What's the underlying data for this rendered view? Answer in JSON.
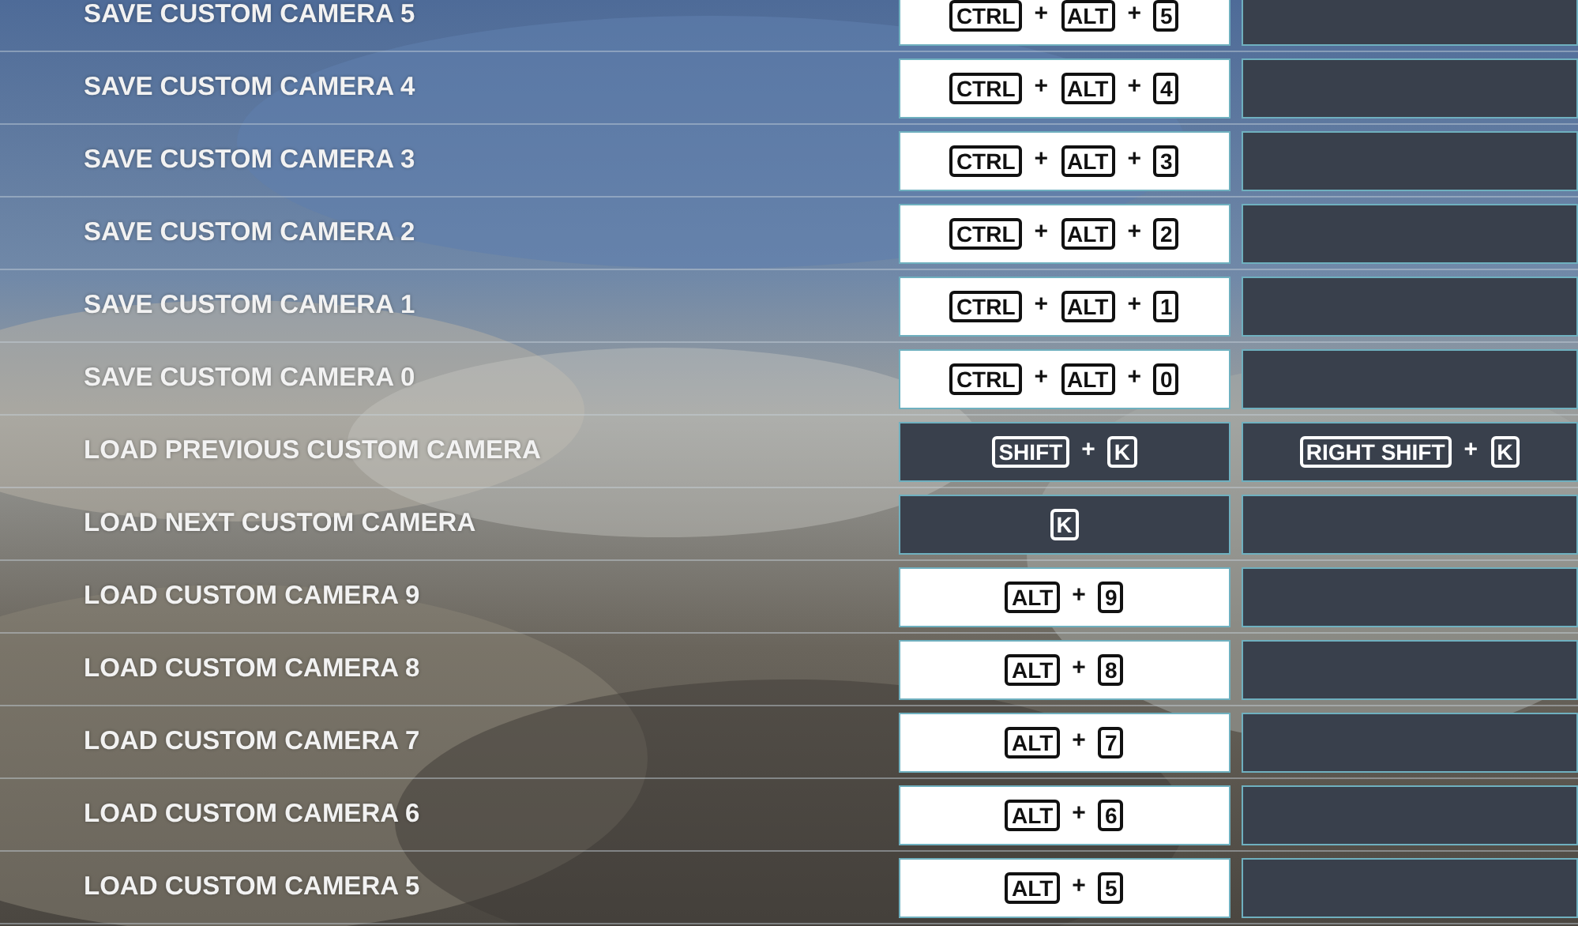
{
  "rows": [
    {
      "action": "SAVE CUSTOM CAMERA 5",
      "slots": [
        {
          "keys": [
            "CTRL",
            "+",
            "ALT",
            "+",
            "5"
          ],
          "highlighted": true
        },
        {
          "highlighted": false
        }
      ]
    },
    {
      "action": "SAVE CUSTOM CAMERA 4",
      "slots": [
        {
          "keys": [
            "CTRL",
            "+",
            "ALT",
            "+",
            "4"
          ],
          "highlighted": true
        },
        {
          "highlighted": false
        }
      ]
    },
    {
      "action": "SAVE CUSTOM CAMERA 3",
      "slots": [
        {
          "keys": [
            "CTRL",
            "+",
            "ALT",
            "+",
            "3"
          ],
          "highlighted": true
        },
        {
          "highlighted": false
        }
      ]
    },
    {
      "action": "SAVE CUSTOM CAMERA 2",
      "slots": [
        {
          "keys": [
            "CTRL",
            "+",
            "ALT",
            "+",
            "2"
          ],
          "highlighted": true
        },
        {
          "highlighted": false
        }
      ]
    },
    {
      "action": "SAVE CUSTOM CAMERA 1",
      "slots": [
        {
          "keys": [
            "CTRL",
            "+",
            "ALT",
            "+",
            "1"
          ],
          "highlighted": true
        },
        {
          "highlighted": false
        }
      ]
    },
    {
      "action": "SAVE CUSTOM CAMERA 0",
      "slots": [
        {
          "keys": [
            "CTRL",
            "+",
            "ALT",
            "+",
            "0"
          ],
          "highlighted": true
        },
        {
          "highlighted": false
        }
      ]
    },
    {
      "action": "LOAD PREVIOUS CUSTOM CAMERA",
      "slots": [
        {
          "keys": [
            "SHIFT",
            "+",
            "K"
          ],
          "highlighted": false
        },
        {
          "keys": [
            "RIGHT SHIFT",
            "+",
            "K"
          ],
          "highlighted": false
        }
      ]
    },
    {
      "action": "LOAD NEXT CUSTOM CAMERA",
      "slots": [
        {
          "keys": [
            "K"
          ],
          "highlighted": false
        },
        {
          "highlighted": false
        }
      ]
    },
    {
      "action": "LOAD CUSTOM CAMERA 9",
      "slots": [
        {
          "keys": [
            "ALT",
            "+",
            "9"
          ],
          "highlighted": true
        },
        {
          "highlighted": false
        }
      ]
    },
    {
      "action": "LOAD CUSTOM CAMERA 8",
      "slots": [
        {
          "keys": [
            "ALT",
            "+",
            "8"
          ],
          "highlighted": true
        },
        {
          "highlighted": false
        }
      ]
    },
    {
      "action": "LOAD CUSTOM CAMERA 7",
      "slots": [
        {
          "keys": [
            "ALT",
            "+",
            "7"
          ],
          "highlighted": true
        },
        {
          "highlighted": false
        }
      ]
    },
    {
      "action": "LOAD CUSTOM CAMERA 6",
      "slots": [
        {
          "keys": [
            "ALT",
            "+",
            "6"
          ],
          "highlighted": true
        },
        {
          "highlighted": false
        }
      ]
    },
    {
      "action": "LOAD CUSTOM CAMERA 5",
      "slots": [
        {
          "keys": [
            "ALT",
            "+",
            "5"
          ],
          "highlighted": true
        },
        {
          "highlighted": false
        }
      ]
    }
  ]
}
